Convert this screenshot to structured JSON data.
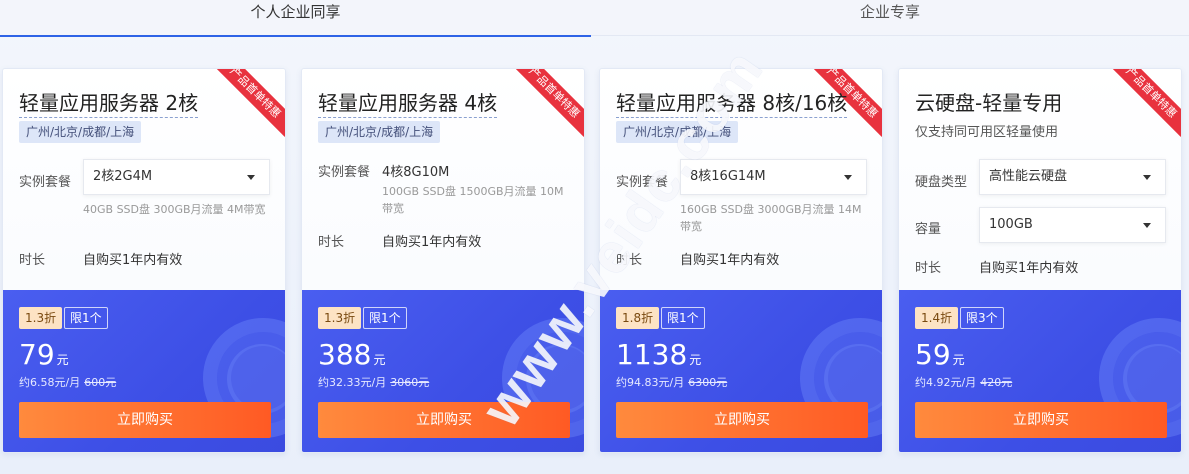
{
  "tabs": [
    {
      "label": "个人企业同享",
      "active": true
    },
    {
      "label": "企业专享",
      "active": false
    }
  ],
  "watermark": "www.veidc.com",
  "colors": {
    "accent": "#2e63e6",
    "card_bottom": "#3d4fe6",
    "buy_button": "#ff6a2c",
    "ribbon": "#e8323e"
  },
  "cards": [
    {
      "ribbon": "产品首单特惠",
      "title": "轻量应用服务器 2核",
      "region": "广州/北京/成都/上海",
      "plan_label": "实例套餐",
      "plan_value": "2核2G4M",
      "plan_spec": "40GB SSD盘 300GB月流量 4M带宽",
      "duration_label": "时长",
      "duration_value": "自购买1年内有效",
      "discount": "1.3折",
      "limit": "限1个",
      "price": "79",
      "price_unit": "元",
      "per_month": "约6.58元/月",
      "original": "600元",
      "buy": "立即购买"
    },
    {
      "ribbon": "产品首单特惠",
      "title": "轻量应用服务器 4核",
      "region": "广州/北京/成都/上海",
      "plan_label": "实例套餐",
      "plan_value": "4核8G10M",
      "plan_spec": "100GB SSD盘 1500GB月流量 10M带宽",
      "duration_label": "时长",
      "duration_value": "自购买1年内有效",
      "discount": "1.3折",
      "limit": "限1个",
      "price": "388",
      "price_unit": "元",
      "per_month": "约32.33元/月",
      "original": "3060元",
      "buy": "立即购买"
    },
    {
      "ribbon": "产品首单特惠",
      "title": "轻量应用服务器 8核/16核",
      "region": "广州/北京/成都/上海",
      "plan_label": "实例套餐",
      "plan_value": "8核16G14M",
      "plan_spec": "160GB SSD盘 3000GB月流量 14M带宽",
      "duration_label": "时长",
      "duration_value": "自购买1年内有效",
      "discount": "1.8折",
      "limit": "限1个",
      "price": "1138",
      "price_unit": "元",
      "per_month": "约94.83元/月",
      "original": "6300元",
      "buy": "立即购买"
    },
    {
      "ribbon": "产品首单特惠",
      "title": "云硬盘-轻量专用",
      "subtitle": "仅支持同可用区轻量使用",
      "disk_type_label": "硬盘类型",
      "disk_type_value": "高性能云硬盘",
      "capacity_label": "容量",
      "capacity_value": "100GB",
      "duration_label": "时长",
      "duration_value": "自购买1年内有效",
      "discount": "1.4折",
      "limit": "限3个",
      "price": "59",
      "price_unit": "元",
      "per_month": "约4.92元/月",
      "original": "420元",
      "buy": "立即购买"
    }
  ]
}
